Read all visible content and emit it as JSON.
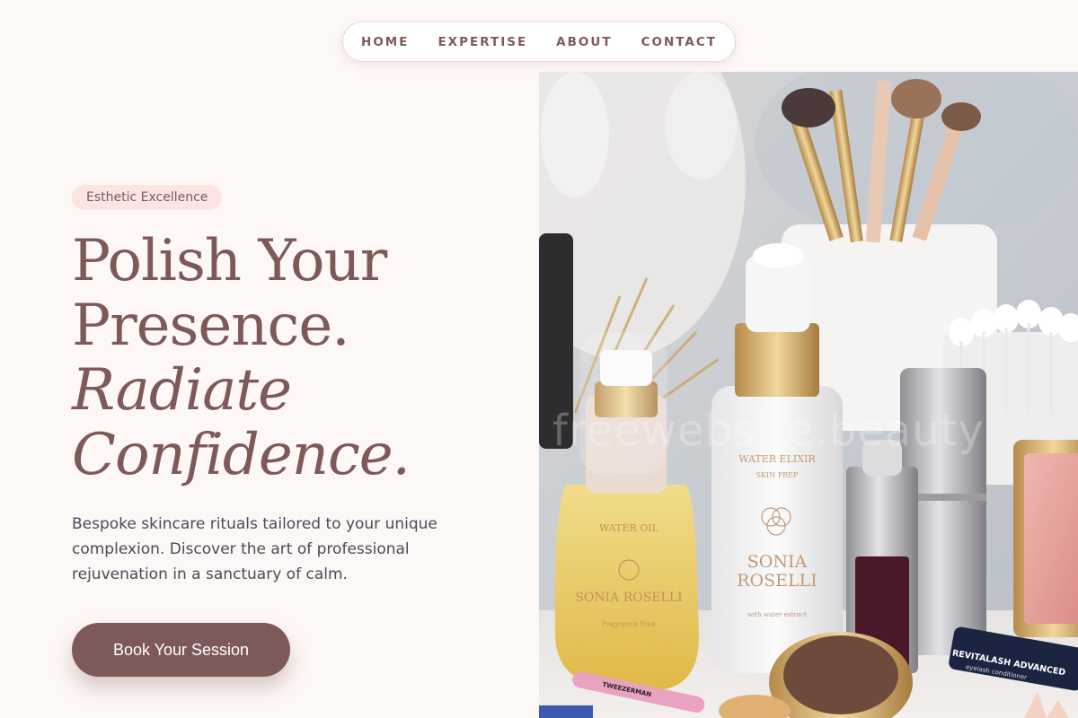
{
  "nav": {
    "items": [
      "HOME",
      "EXPERTISE",
      "ABOUT",
      "CONTACT"
    ]
  },
  "hero": {
    "badge": "Esthetic Excellence",
    "headline_line1": "Polish Your",
    "headline_line2": "Presence.",
    "headline_line3": "Radiate",
    "headline_line4": "Confidence.",
    "description": "Bespoke skincare rituals tailored to your unique complexion. Discover the art of professional rejuvenation in a sanctuary of calm.",
    "cta_label": "Book Your Session"
  },
  "image": {
    "watermark": "freewebsite.beauty",
    "product_labels": {
      "left_bottle_line1": "WATER OIL",
      "left_bottle_brand": "SONIA ROSELLI",
      "left_bottle_sub": "Fragrance Free",
      "center_bottle_line1": "WATER ELIXIR",
      "center_bottle_line2": "SKIN PREP",
      "center_bottle_brand_1": "SONIA",
      "center_bottle_brand_2": "ROSELLI",
      "center_bottle_sub": "with water extract",
      "tweezer_label": "TWEEZERMAN",
      "mascara_label": "REVITALASH ADVANCED",
      "mascara_sub": "eyelash conditioner"
    }
  },
  "colors": {
    "accent": "#7d5a58",
    "background": "#fdf7f6",
    "badge_bg": "#fbe4e2",
    "body_text": "#4d4a56"
  }
}
